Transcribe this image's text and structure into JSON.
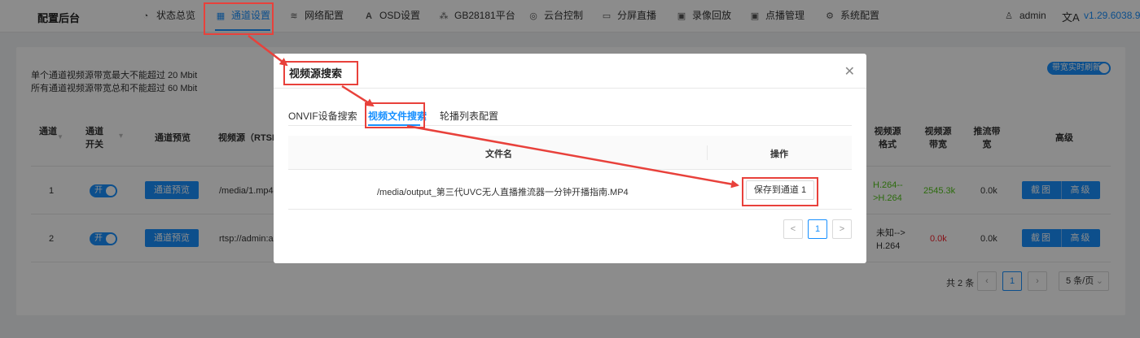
{
  "nav": {
    "brand": "配置后台",
    "items": [
      {
        "label": "状态总览",
        "icon": "dashboard-icon",
        "active": false
      },
      {
        "label": "通道设置",
        "icon": "grid-icon",
        "active": true
      },
      {
        "label": "网络配置",
        "icon": "wifi-icon",
        "active": false
      },
      {
        "label": "OSD设置",
        "icon": "osd-icon",
        "active": false
      },
      {
        "label": "GB28181平台",
        "icon": "nodes-icon",
        "active": false
      },
      {
        "label": "云台控制",
        "icon": "compass-icon",
        "active": false
      },
      {
        "label": "分屏直播",
        "icon": "monitor-icon",
        "active": false
      },
      {
        "label": "录像回放",
        "icon": "record-icon",
        "active": false
      },
      {
        "label": "点播管理",
        "icon": "vod-icon",
        "active": false
      },
      {
        "label": "系统配置",
        "icon": "gear-icon",
        "active": false
      }
    ],
    "user": "admin",
    "lang_glyph": "文A",
    "version": "v1.29.6038.92"
  },
  "page": {
    "note_line1": "单个通道视频源带宽最大不能超过 20 Mbit",
    "note_line2": "所有通道视频源带宽总和不能超过 60 Mbit",
    "realtime_refresh": "带宽实时刷新",
    "table": {
      "headers": {
        "channel": "通道",
        "switch": "通道开关",
        "preview": "通道预览",
        "source": "视频源（RTSP...",
        "format": "视频源格式",
        "bandwidth": "视频源带宽",
        "push": "推流带宽",
        "advanced": "高级"
      },
      "rows": [
        {
          "channel": "1",
          "switch": "开",
          "preview": "通道预览",
          "source": "/media/1.mp4",
          "format": "H.264-->H.264",
          "bandwidth": "2545.3k",
          "push": "0.0k",
          "btn1": "截图",
          "btn2": "高级"
        },
        {
          "channel": "2",
          "switch": "开",
          "preview": "通道预览",
          "source": "rtsp://admin:a",
          "format": "未知-->H.264",
          "bandwidth": "0.0k",
          "push": "0.0k",
          "btn1": "截图",
          "btn2": "高级"
        }
      ]
    },
    "pager": {
      "total": "共 2 条",
      "current": "1",
      "size": "5 条/页"
    }
  },
  "modal": {
    "title": "视频源搜索",
    "tabs": [
      "ONVIF设备搜索",
      "视频文件搜索",
      "轮播列表配置"
    ],
    "active_tab": 1,
    "table": {
      "col_filename": "文件名",
      "col_action": "操作",
      "rows": [
        {
          "filename": "/media/output_第三代UVC无人直播推流器一分钟开播指南.MP4",
          "action": "保存到通道 1"
        }
      ]
    },
    "pager": {
      "prev": "<",
      "current": "1",
      "next": ">"
    }
  },
  "colors": {
    "accent": "#1890ff",
    "annotation": "#e8413b",
    "success": "#52c41a",
    "danger": "#f5222d"
  }
}
